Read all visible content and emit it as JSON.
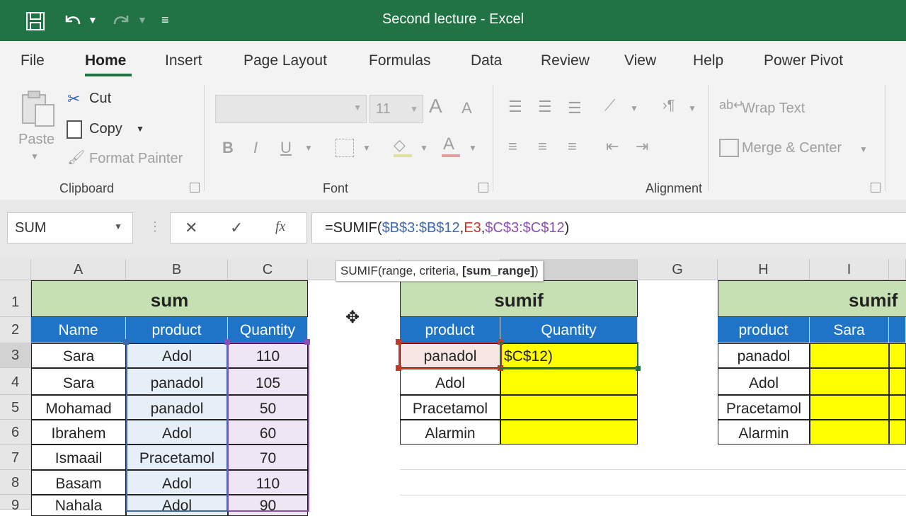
{
  "window": {
    "title": "Second lecture  -  Excel"
  },
  "tabs": [
    "File",
    "Home",
    "Insert",
    "Page Layout",
    "Formulas",
    "Data",
    "Review",
    "View",
    "Help",
    "Power Pivot"
  ],
  "ribbon": {
    "clipboard": {
      "paste": "Paste",
      "cut": "Cut",
      "copy": "Copy",
      "format_painter": "Format Painter",
      "label": "Clipboard"
    },
    "font": {
      "size": "11",
      "grow": "A",
      "shrink": "A",
      "bold": "B",
      "italic": "I",
      "underline": "U",
      "label": "Font"
    },
    "alignment": {
      "wrap_text": "Wrap Text",
      "merge_center": "Merge & Center",
      "label": "Alignment"
    }
  },
  "formula_bar": {
    "name_box": "SUM",
    "cancel": "✕",
    "enter": "✓",
    "fx": "fx",
    "parts": [
      "=SUMIF(",
      "$B$3:$B$12",
      ",",
      "E3",
      ",",
      "$C$3:$C$12",
      ")"
    ],
    "tooltip_prefix": "SUMIF(range, criteria, ",
    "tooltip_bold": "[sum_range]",
    "tooltip_suffix": ")"
  },
  "columns": [
    "A",
    "B",
    "C",
    "G",
    "H",
    "I"
  ],
  "rows": [
    "1",
    "2",
    "3",
    "4",
    "5",
    "6",
    "7",
    "8",
    "9"
  ],
  "table1": {
    "title": "sum",
    "headers": [
      "Name",
      "product",
      "Quantity"
    ],
    "rows": [
      [
        "Sara",
        "Adol",
        "110"
      ],
      [
        "Sara",
        "panadol",
        "105"
      ],
      [
        "Mohamad",
        "panadol",
        "50"
      ],
      [
        "Ibrahem",
        "Adol",
        "60"
      ],
      [
        "Ismaail",
        "Pracetamol",
        "70"
      ],
      [
        "Basam",
        "Adol",
        "110"
      ],
      [
        "Nahala",
        "Adol",
        "90"
      ]
    ]
  },
  "table2": {
    "title": "sumif",
    "headers": [
      "product",
      "Quantity"
    ],
    "rows": [
      "panadol",
      "Adol",
      "Pracetamol",
      "Alarmin"
    ],
    "editing_text": "$C$12)"
  },
  "table3": {
    "title": "sumif",
    "headers": [
      "product",
      "Sara"
    ],
    "rows": [
      "panadol",
      "Adol",
      "Pracetamol",
      "Alarmin"
    ]
  },
  "colors": {
    "excel_green": "#217346",
    "header_blue": "#1f74c8",
    "title_green": "#c6e0b4",
    "highlight": "#ffff00"
  }
}
